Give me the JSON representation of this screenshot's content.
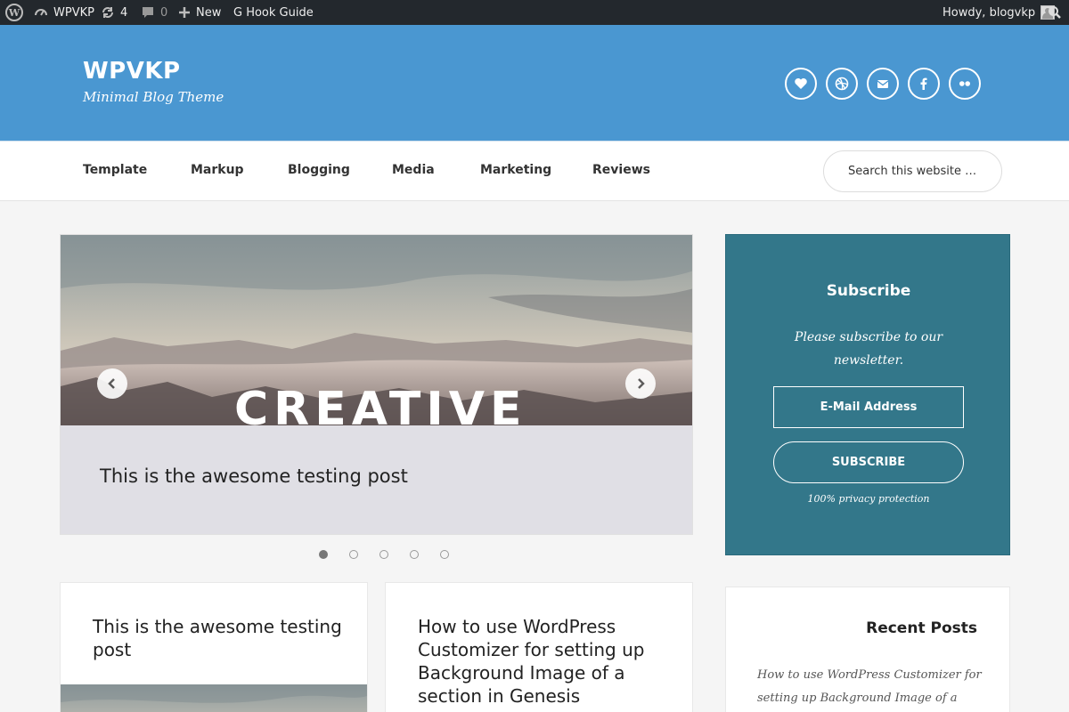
{
  "adminbar": {
    "site_name": "WPVKP",
    "updates_count": "4",
    "comments_count": "0",
    "new_label": "New",
    "hook_guide_label": "G Hook Guide",
    "howdy": "Howdy, blogvkp"
  },
  "header": {
    "title": "WPVKP",
    "description": "Minimal Blog Theme",
    "background_color": "#4a97d1",
    "social_icons": [
      "heart-icon",
      "dribbble-icon",
      "email-icon",
      "facebook-icon",
      "flickr-icon"
    ]
  },
  "nav": {
    "items": [
      "Template",
      "Markup",
      "Blogging",
      "Media",
      "Marketing",
      "Reviews"
    ],
    "search_placeholder": "Search this website …"
  },
  "slider": {
    "image_text": "CREATIVE",
    "caption": "This is the awesome testing post",
    "slide_count": 5,
    "active_slide": 1
  },
  "subscribe": {
    "title": "Subscribe",
    "text": "Please subscribe to our newsletter.",
    "email_placeholder": "E-Mail Address",
    "button_label": "SUBSCRIBE",
    "privacy": "100% privacy protection",
    "background_color": "#33778a"
  },
  "posts": [
    {
      "title": "This is the awesome testing post"
    },
    {
      "title": "How to use WordPress Customizer for setting up Background Image of a section in Genesis"
    }
  ],
  "recent_posts": {
    "title": "Recent Posts",
    "items": [
      "How to use WordPress Customizer for setting up Background Image of a section in"
    ]
  }
}
